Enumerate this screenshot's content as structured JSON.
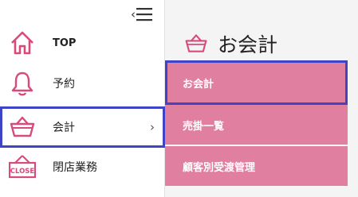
{
  "sidebar": {
    "items": [
      {
        "label": "TOP",
        "icon": "home-icon"
      },
      {
        "label": "予約",
        "icon": "bell-icon"
      },
      {
        "label": "会計",
        "icon": "basket-icon",
        "arrow": "›"
      },
      {
        "label": "閉店業務",
        "icon": "close-sign-icon",
        "icon_text": "CLOSE"
      }
    ]
  },
  "content": {
    "title": "お会計"
  },
  "submenu": {
    "items": [
      {
        "label": "お会計"
      },
      {
        "label": "売掛一覧"
      },
      {
        "label": "顧客別受渡管理"
      }
    ]
  },
  "colors": {
    "accent": "#d84a7a",
    "submenu_bg": "#e07fa0",
    "focus": "#3e44c4"
  }
}
